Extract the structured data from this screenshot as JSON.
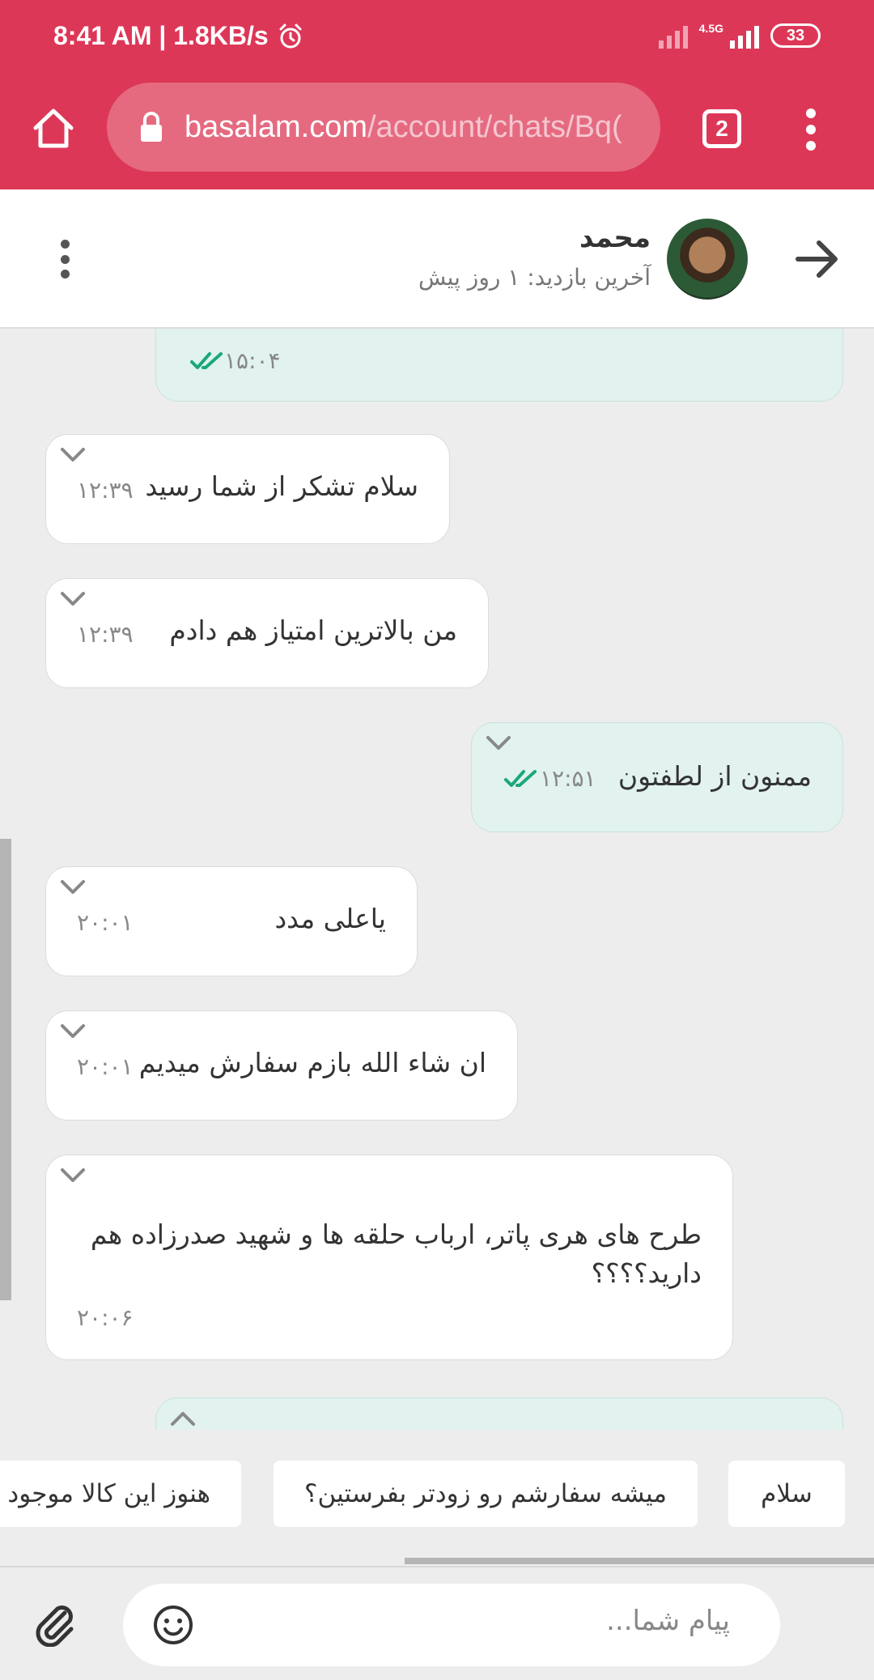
{
  "status_bar": {
    "time_speed": "8:41 AM | 1.8KB/s",
    "network_label": "4.5G",
    "battery": "33",
    "icons": [
      "alarm-icon",
      "signal-icon",
      "battery-icon"
    ]
  },
  "browser": {
    "url_host": "basalam.com",
    "url_path": "/account/chats/Bq(",
    "tab_count": "2",
    "colors": {
      "toolbar": "#dd3757",
      "url_pill": "#e56a80"
    }
  },
  "chat_header": {
    "name": "محمد",
    "last_seen": "آخرین بازدید: ۱ روز پیش"
  },
  "messages": [
    {
      "direction": "out",
      "text": "",
      "time": "۱۵:۰۴",
      "read": true
    },
    {
      "direction": "in",
      "text": "سلام تشکر از شما رسید",
      "time": "۱۲:۳۹"
    },
    {
      "direction": "in",
      "text": "من بالاترین امتیاز هم دادم",
      "time": "۱۲:۳۹"
    },
    {
      "direction": "out",
      "text": "ممنون از لطفتون",
      "time": "۱۲:۵۱",
      "read": true
    },
    {
      "direction": "in",
      "text": "یاعلی مدد",
      "time": "۲۰:۰۱"
    },
    {
      "direction": "in",
      "text": "ان شاء الله بازم سفارش میدیم",
      "time": "۲۰:۰۱"
    },
    {
      "direction": "in",
      "text": "طرح های هری پاتر، ارباب حلقه ها و شهید صدرزاده هم دارید؟؟؟؟",
      "time": "۲۰:۰۶"
    }
  ],
  "quick_replies": [
    "سلام",
    "میشه سفارشم رو زودتر بفرستین؟",
    "هنوز این کالا موجود"
  ],
  "composer": {
    "placeholder": "پیام شما..."
  },
  "colors": {
    "incoming_bubble": "#ffffff",
    "outgoing_bubble": "#e1f2ef",
    "read_ticks": "#1aa879"
  }
}
